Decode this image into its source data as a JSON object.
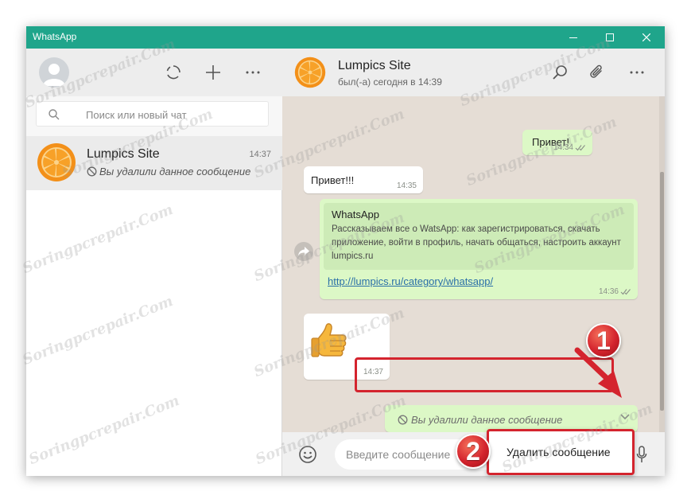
{
  "window": {
    "title": "WhatsApp"
  },
  "sidebar": {
    "search": {
      "placeholder": "Поиск или новый чат"
    },
    "chat": {
      "name": "Lumpics Site",
      "time": "14:37",
      "last_message": "Вы удалили данное сообщение"
    }
  },
  "chat": {
    "header": {
      "name": "Lumpics Site",
      "status": "был(-а) сегодня в 14:39"
    },
    "messages": [
      {
        "direction": "out",
        "text": "Привет!",
        "time": "14:34"
      },
      {
        "direction": "in",
        "text": "Привет!!!",
        "time": "14:35"
      },
      {
        "direction": "out",
        "preview_title": "WhatsApp",
        "preview_description": "Рассказываем все о WatsApp: как зарегистрироваться, скачать приложение, войти в профиль, начать общаться, настроить аккаунт lumpics.ru",
        "link": "http://lumpics.ru/category/whatsapp/",
        "time": "14:36"
      },
      {
        "direction": "in",
        "sticker": "thumbs-up",
        "time": "14:37"
      },
      {
        "direction": "out",
        "text": "Вы удалили данное сообщение"
      }
    ],
    "composer": {
      "placeholder": "Введите сообщение"
    },
    "context_menu": {
      "delete_label": "Удалить сообщение"
    }
  },
  "annotations": {
    "step1": "1",
    "step2": "2"
  },
  "watermark": "Soringpcrepair.Com",
  "colors": {
    "titlebar": "#1fa58b",
    "outgoing_bubble": "#dcf8c6",
    "chat_background": "#e5ddd5",
    "highlight": "#d4242e"
  }
}
